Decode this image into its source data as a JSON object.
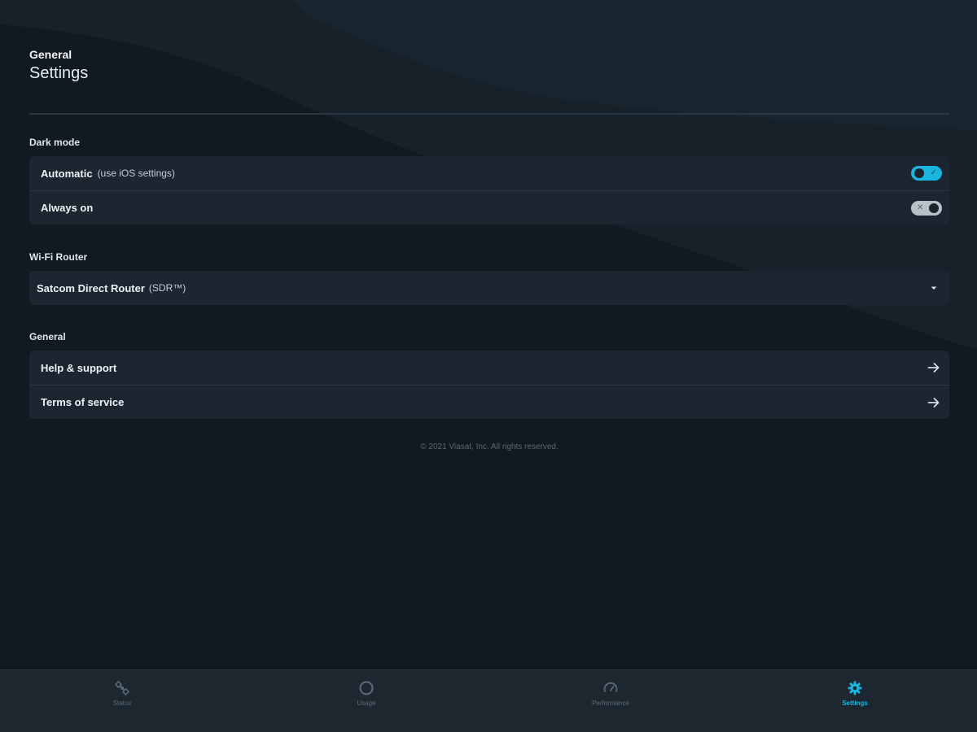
{
  "header": {
    "eyebrow": "General",
    "title": "Settings"
  },
  "dark_mode": {
    "section_label": "Dark mode",
    "automatic": {
      "label": "Automatic",
      "sublabel": "(use iOS settings)",
      "enabled": true
    },
    "always_on": {
      "label": "Always on",
      "enabled": false
    }
  },
  "wifi_router": {
    "section_label": "Wi-Fi Router",
    "selected": "Satcom Direct Router",
    "selected_suffix": "(SDR™)",
    "icon": "caret-down-icon"
  },
  "general": {
    "section_label": "General",
    "items": [
      {
        "label": "Help & support",
        "icon": "arrow-right-icon"
      },
      {
        "label": "Terms of service",
        "icon": "arrow-right-icon"
      }
    ]
  },
  "copyright": "© 2021 Viasat, Inc. All rights reserved.",
  "tabbar": {
    "tabs": [
      {
        "label": "Status",
        "icon": "satellite-icon",
        "active": false
      },
      {
        "label": "Usage",
        "icon": "usage-ring-icon",
        "active": false
      },
      {
        "label": "Performance",
        "icon": "speedometer-icon",
        "active": false
      },
      {
        "label": "Settings",
        "icon": "gear-icon",
        "active": true
      }
    ]
  },
  "colors": {
    "background": "#121a21",
    "card": "#1c2630",
    "accent": "#18b6de",
    "tab_inactive": "#5e6b76",
    "toggle_off": "#b7c1c9"
  }
}
